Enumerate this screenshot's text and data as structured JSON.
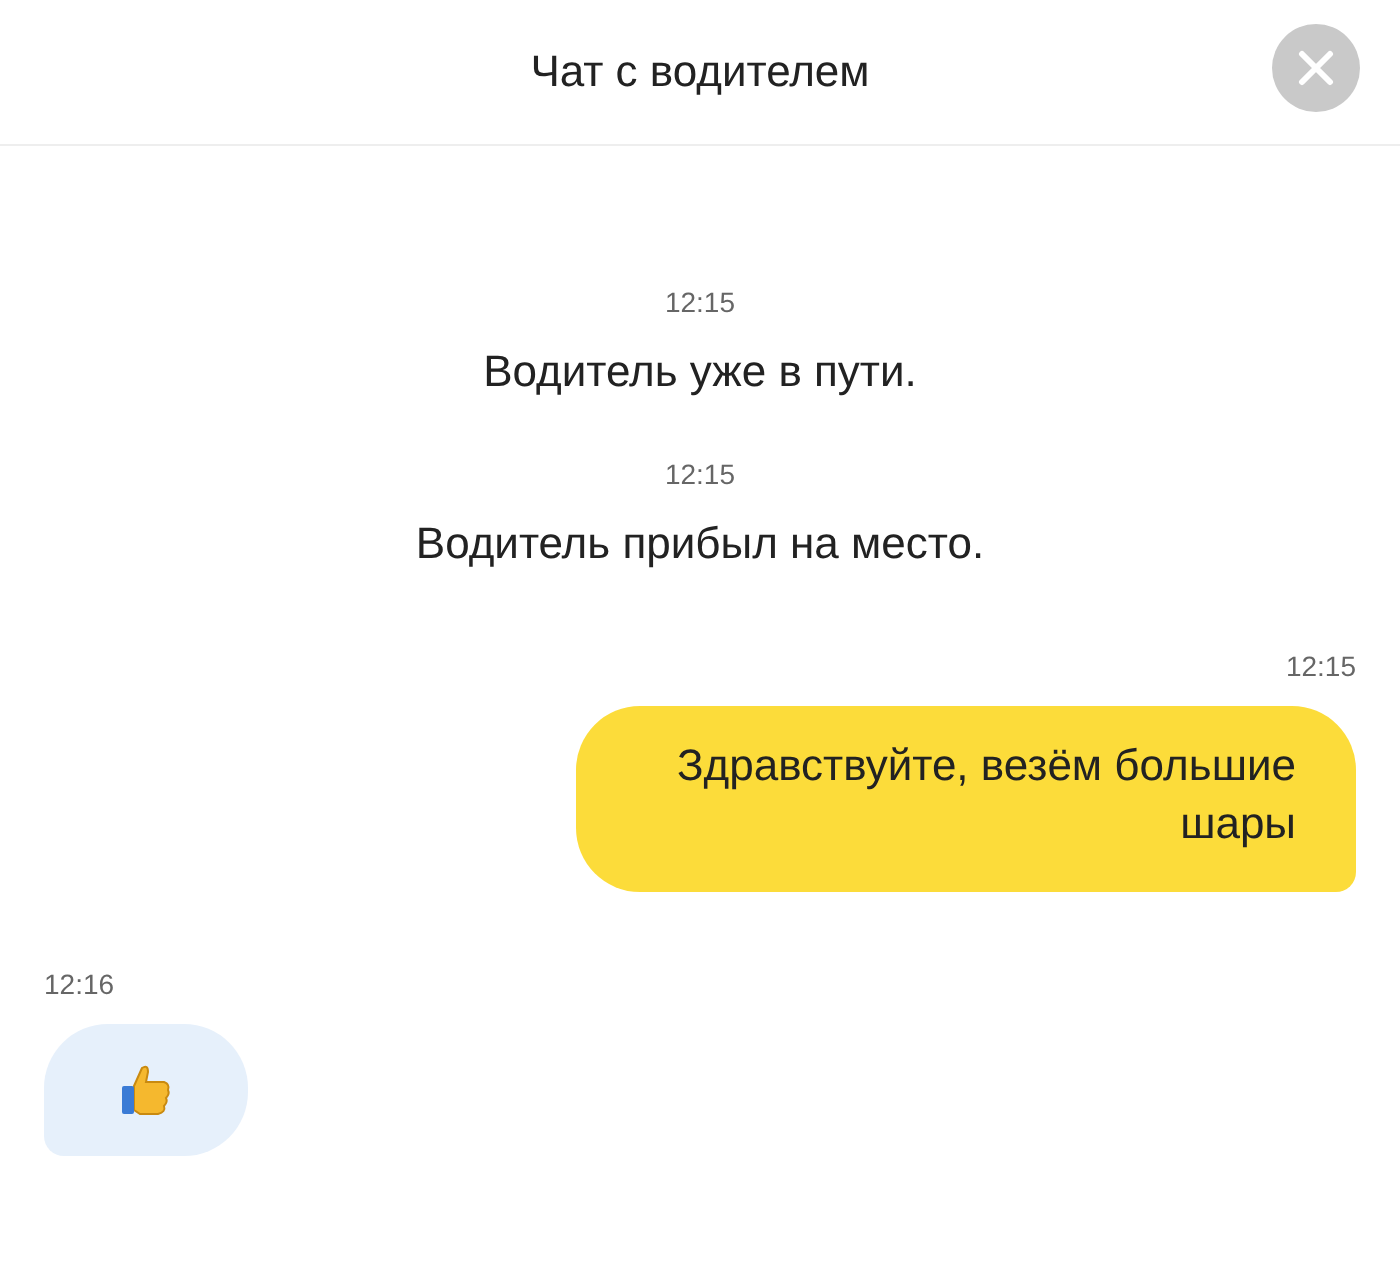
{
  "header": {
    "title": "Чат с водителем"
  },
  "messages": [
    {
      "kind": "system",
      "time": "12:15",
      "text": "Водитель уже в пути."
    },
    {
      "kind": "system",
      "time": "12:15",
      "text": "Водитель прибыл на место."
    },
    {
      "kind": "outgoing",
      "time": "12:15",
      "text": "Здравствуйте, везём большие шары"
    },
    {
      "kind": "reaction",
      "time": "12:16"
    }
  ]
}
